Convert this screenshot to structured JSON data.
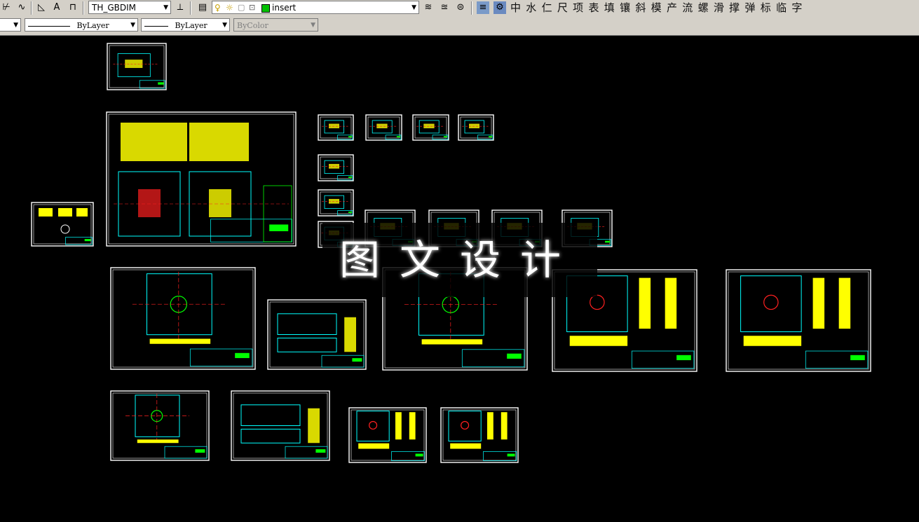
{
  "toolbar1": {
    "dimstyle_value": "TH_GBDIM",
    "layer_value": "insert",
    "layer_color": "#00c000",
    "cjk_buttons": [
      "中",
      "水",
      "仁",
      "尺",
      "项",
      "表",
      "填",
      "镶",
      "斜",
      "模",
      "产",
      "流",
      "螺",
      "滑",
      "撑",
      "弹",
      "标",
      "临",
      "字"
    ]
  },
  "toolbar2": {
    "linetype_value": "ByLayer",
    "lineweight_value": "ByLayer",
    "plotstyle_value": "ByColor"
  },
  "watermark": {
    "text": "图文设计"
  },
  "colors": {
    "canvas": "#000000",
    "frame": "#ffffff",
    "cyan": "#00ffff",
    "yellow": "#ffff00",
    "red": "#ff2020",
    "green": "#00ff00",
    "magenta": "#ff00ff"
  }
}
